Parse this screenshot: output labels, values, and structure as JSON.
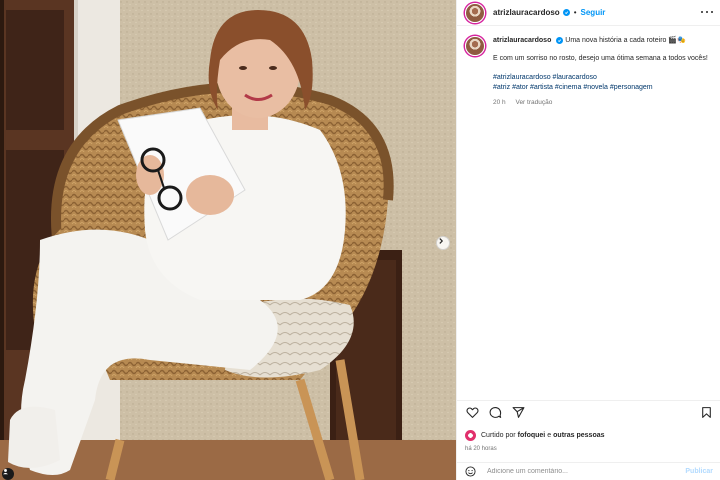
{
  "header": {
    "username": "atrizlauracardoso",
    "separator": "•",
    "follow_label": "Seguir"
  },
  "caption": {
    "username": "atrizlauracardoso",
    "headline": "Uma nova história a cada roteiro 🎬🎭",
    "body": "E com um sorriso no rosto, desejo uma ótima semana a todos vocês!",
    "hashtags_line1": [
      "#atrizlauracardoso",
      "#lauracardoso"
    ],
    "hashtags_line2": [
      "#atriz",
      "#ator",
      "#artista",
      "#cinema",
      "#novela",
      "#personagem"
    ],
    "time": "20 h",
    "translate_label": "Ver tradução"
  },
  "likes": {
    "prefix": "Curtido por",
    "user": "fofoquei",
    "conjunction": "e",
    "others": "outras pessoas"
  },
  "posted_ago": "há 20 horas",
  "comment": {
    "placeholder": "Adicione um comentário...",
    "publish_label": "Publicar"
  },
  "icons": {
    "like": "heart-icon",
    "comment": "comment-icon",
    "share": "share-icon",
    "save": "bookmark-icon",
    "emoji": "smiley-icon",
    "more": "more-options-icon",
    "next": "chevron-right-icon"
  },
  "colors": {
    "link": "#0095f6",
    "hashtag": "#00376b",
    "muted": "#737373",
    "publish_disabled": "#b3dbff"
  }
}
